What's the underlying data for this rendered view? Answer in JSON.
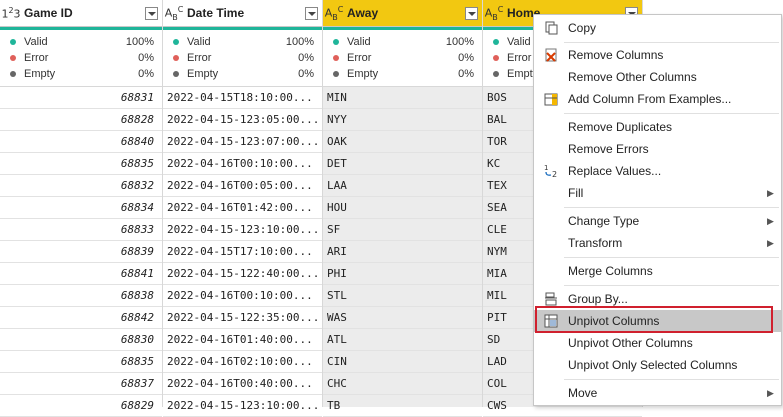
{
  "columns": [
    {
      "type_icon": "123",
      "name": "Game ID",
      "stats": {
        "valid_label": "Valid",
        "valid_pct": "100%",
        "error_label": "Error",
        "error_pct": "0%",
        "empty_label": "Empty",
        "empty_pct": "0%"
      },
      "values": [
        "68831",
        "68828",
        "68840",
        "68835",
        "68832",
        "68834",
        "68833",
        "68839",
        "68841",
        "68838",
        "68842",
        "68830",
        "68835",
        "68837",
        "68829"
      ]
    },
    {
      "type_icon": "ABC",
      "name": "Date Time",
      "stats": {
        "valid_label": "Valid",
        "valid_pct": "100%",
        "error_label": "Error",
        "error_pct": "0%",
        "empty_label": "Empty",
        "empty_pct": "0%"
      },
      "values": [
        "2022-04-15T18:10:00...",
        "2022-04-15-123:05:00...",
        "2022-04-15-123:07:00...",
        "2022-04-16T00:10:00...",
        "2022-04-16T00:05:00...",
        "2022-04-16T01:42:00...",
        "2022-04-15-123:10:00...",
        "2022-04-15T17:10:00...",
        "2022-04-15-122:40:00...",
        "2022-04-16T00:10:00...",
        "2022-04-15-122:35:00...",
        "2022-04-16T01:40:00...",
        "2022-04-16T02:10:00...",
        "2022-04-16T00:40:00...",
        "2022-04-15-123:10:00..."
      ]
    },
    {
      "type_icon": "ABC",
      "name": "Away",
      "stats": {
        "valid_label": "Valid",
        "valid_pct": "100%",
        "error_label": "Error",
        "error_pct": "0%",
        "empty_label": "Empty",
        "empty_pct": "0%"
      },
      "values": [
        "MIN",
        "NYY",
        "OAK",
        "DET",
        "LAA",
        "HOU",
        "SF",
        "ARI",
        "PHI",
        "STL",
        "WAS",
        "ATL",
        "CIN",
        "CHC",
        "TB"
      ]
    },
    {
      "type_icon": "ABC",
      "name": "Home",
      "stats": {
        "valid_label": "Valid",
        "valid_pct": "",
        "error_label": "Error",
        "error_pct": "",
        "empty_label": "Empty",
        "empty_pct": ""
      },
      "values": [
        "BOS",
        "BAL",
        "TOR",
        "KC",
        "TEX",
        "SEA",
        "CLE",
        "NYM",
        "MIA",
        "MIL",
        "PIT",
        "SD",
        "LAD",
        "COL",
        "CWS"
      ]
    }
  ],
  "colors": {
    "valid": "#1fb59a",
    "error": "#e0605a",
    "empty": "#666666",
    "selected_header": "#f2c811",
    "highlight_box": "#d0202e"
  },
  "context_menu": {
    "items": [
      {
        "label": "Copy",
        "icon": "copy-icon"
      },
      {
        "label": "Remove Columns",
        "icon": "remove-columns-icon"
      },
      {
        "label": "Remove Other Columns"
      },
      {
        "label": "Add Column From Examples...",
        "icon": "add-column-examples-icon"
      },
      {
        "label": "Remove Duplicates"
      },
      {
        "label": "Remove Errors"
      },
      {
        "label": "Replace Values...",
        "icon": "replace-values-icon"
      },
      {
        "label": "Fill",
        "submenu": true
      },
      {
        "label": "Change Type",
        "submenu": true
      },
      {
        "label": "Transform",
        "submenu": true
      },
      {
        "label": "Merge Columns"
      },
      {
        "label": "Group By...",
        "icon": "group-by-icon"
      },
      {
        "label": "Unpivot Columns",
        "icon": "unpivot-icon",
        "highlighted": true
      },
      {
        "label": "Unpivot Other Columns"
      },
      {
        "label": "Unpivot Only Selected Columns"
      },
      {
        "label": "Move",
        "submenu": true
      }
    ]
  }
}
